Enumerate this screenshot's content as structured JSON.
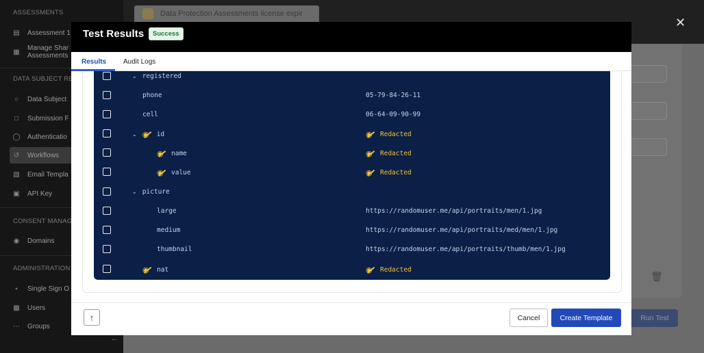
{
  "sidebar": {
    "sections": [
      "ASSESSMENTS",
      "DATA SUBJECT RE",
      "CONSENT MANAG",
      "ADMINISTRATION"
    ],
    "items": [
      {
        "label": "Assessment 1",
        "icon": "document-icon"
      },
      {
        "label": "Manage Shar",
        "label2": "Assessments",
        "icon": "shared-assessments-icon"
      },
      {
        "label": "Data Subject",
        "icon": "data-subject-icon"
      },
      {
        "label": "Submission F",
        "icon": "submission-icon"
      },
      {
        "label": "Authenticatio",
        "icon": "shield-icon"
      },
      {
        "label": "Workflows",
        "icon": "workflow-icon"
      },
      {
        "label": "Email Templa",
        "icon": "email-template-icon"
      },
      {
        "label": "API Key",
        "icon": "lock-icon"
      },
      {
        "label": "Domains",
        "icon": "globe-icon"
      },
      {
        "label": "Single Sign O",
        "icon": "key-icon"
      },
      {
        "label": "Users",
        "icon": "user-icon"
      },
      {
        "label": "Groups",
        "icon": "groups-icon"
      }
    ]
  },
  "background": {
    "banner_text": "Data Protection Assessments license expir",
    "run_test_label": "Run Test"
  },
  "modal": {
    "title": "Test Results",
    "status_badge": "Success",
    "tabs": [
      {
        "label": "Results",
        "active": true
      },
      {
        "label": "Audit Logs",
        "active": false
      }
    ],
    "rows": [
      {
        "key": "registered",
        "value": "",
        "expandable": true,
        "hidden": false,
        "indent": 0
      },
      {
        "key": "phone",
        "value": "05-79-84-26-11",
        "expandable": false,
        "hidden": false,
        "indent": 0
      },
      {
        "key": "cell",
        "value": "06-64-09-90-99",
        "expandable": false,
        "hidden": false,
        "indent": 0
      },
      {
        "key": "id",
        "value": "Redacted",
        "expandable": true,
        "hidden": true,
        "indent": 0
      },
      {
        "key": "name",
        "value": "Redacted",
        "expandable": false,
        "hidden": true,
        "indent": 1
      },
      {
        "key": "value",
        "value": "Redacted",
        "expandable": false,
        "hidden": true,
        "indent": 1
      },
      {
        "key": "picture",
        "value": "",
        "expandable": true,
        "hidden": false,
        "indent": 0
      },
      {
        "key": "large",
        "value": "https://randomuser.me/api/portraits/men/1.jpg",
        "expandable": false,
        "hidden": false,
        "indent": 1
      },
      {
        "key": "medium",
        "value": "https://randomuser.me/api/portraits/med/men/1.jpg",
        "expandable": false,
        "hidden": false,
        "indent": 1
      },
      {
        "key": "thumbnail",
        "value": "https://randomuser.me/api/portraits/thumb/men/1.jpg",
        "expandable": false,
        "hidden": false,
        "indent": 1
      },
      {
        "key": "nat",
        "value": "Redacted",
        "expandable": false,
        "hidden": true,
        "indent": 0
      }
    ],
    "cancel_label": "Cancel",
    "create_label": "Create Template"
  }
}
